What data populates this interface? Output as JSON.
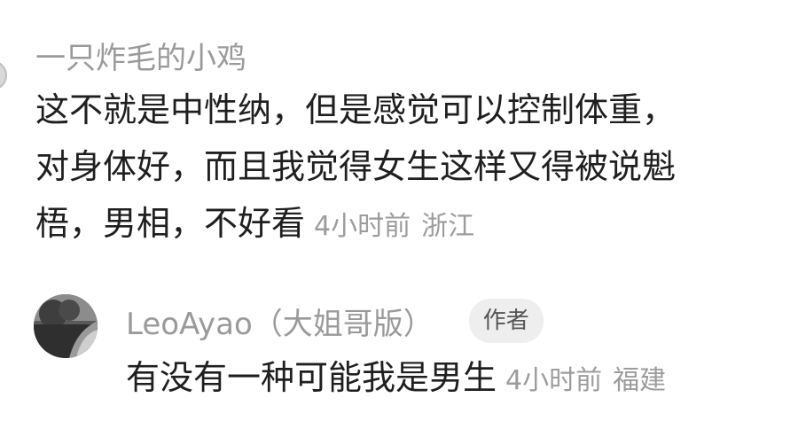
{
  "comment": {
    "username": "一只炸毛的小鸡",
    "text_lines": [
      "这不就是中性纳，但是感觉可以控制体重，",
      "对身体好，而且我觉得女生这样又得被说魁",
      "梧，男相，不好看"
    ],
    "time": "4小时前",
    "location": "浙江"
  },
  "reply": {
    "username": "LeoAyao（大姐哥版）",
    "badge": "作者",
    "text": "有没有一种可能我是男生",
    "time": "4小时前",
    "location": "福建"
  }
}
